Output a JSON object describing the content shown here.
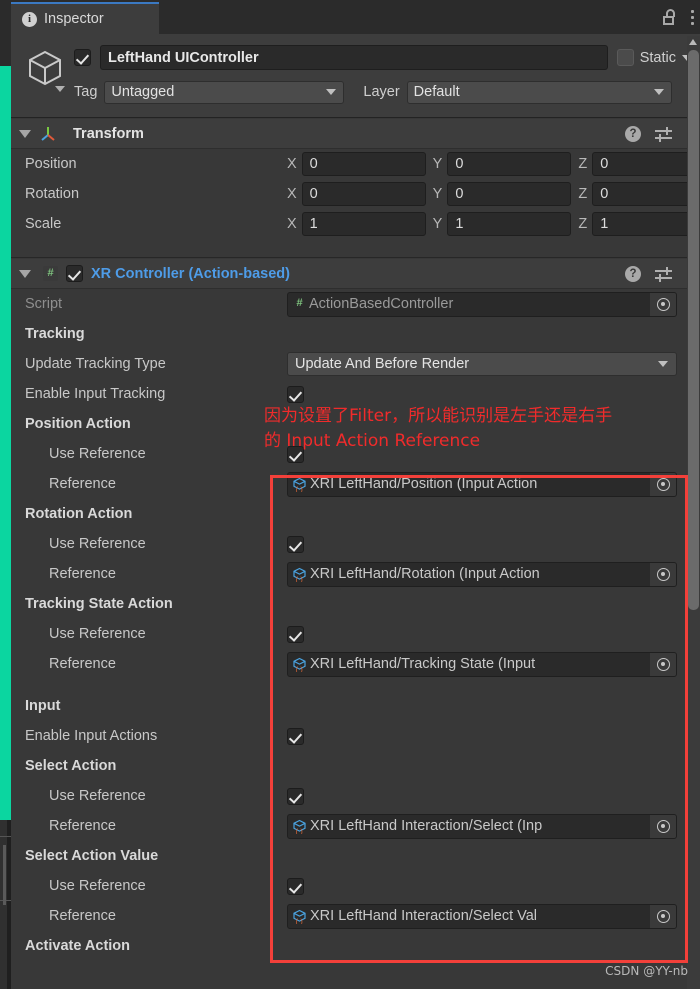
{
  "window": {
    "tab_label": "Inspector",
    "info_icon": "info-icon",
    "lock_icon": "lock-icon",
    "menu_icon": "kebab-menu-icon"
  },
  "colors": {
    "panel_bg": "#383838",
    "header_bg": "#3d3d3d",
    "accent_tab": "#3b79c2",
    "component_link": "#4e9ce8",
    "annotation_red": "#f3403a",
    "scene_teal": "#0bd6a0"
  },
  "game_object": {
    "enabled": true,
    "name": "LeftHand UIController",
    "static_label": "Static",
    "static_checked": false,
    "tag_label": "Tag",
    "tag_value": "Untagged",
    "layer_label": "Layer",
    "layer_value": "Default"
  },
  "transform": {
    "title": "Transform",
    "rows": [
      {
        "label": "Position",
        "x": "0",
        "y": "0",
        "z": "0"
      },
      {
        "label": "Rotation",
        "x": "0",
        "y": "0",
        "z": "0"
      },
      {
        "label": "Scale",
        "x": "1",
        "y": "1",
        "z": "1"
      }
    ],
    "axes": {
      "x": "X",
      "y": "Y",
      "z": "Z"
    }
  },
  "xr_controller": {
    "title": "XR Controller (Action-based)",
    "enabled": true,
    "script_label": "Script",
    "script_value": "ActionBasedController",
    "sections": {
      "tracking": "Tracking",
      "input": "Input"
    },
    "update_tracking_type_label": "Update Tracking Type",
    "update_tracking_type_value": "Update And Before Render",
    "enable_input_tracking_label": "Enable Input Tracking",
    "enable_input_tracking_checked": true,
    "enable_input_actions_label": "Enable Input Actions",
    "enable_input_actions_checked": true,
    "use_reference_label": "Use Reference",
    "reference_label": "Reference",
    "groups": [
      {
        "title": "Position Action",
        "use_reference": true,
        "reference": "XRI LeftHand/Position (Input Action"
      },
      {
        "title": "Rotation Action",
        "use_reference": true,
        "reference": "XRI LeftHand/Rotation (Input Action"
      },
      {
        "title": "Tracking State Action",
        "use_reference": true,
        "reference": "XRI LeftHand/Tracking State (Input"
      },
      {
        "title": "Select Action",
        "use_reference": true,
        "reference": "XRI LeftHand Interaction/Select (Inp"
      },
      {
        "title": "Select Action Value",
        "use_reference": true,
        "reference": "XRI LeftHand Interaction/Select Val"
      },
      {
        "title": "Activate Action",
        "use_reference": true,
        "reference": ""
      }
    ]
  },
  "annotation": {
    "text": "因为设置了Filter，所以能识别是左手还是右手\n的 Input Action Reference"
  },
  "watermark": {
    "text": "CSDN @YY-nb"
  }
}
